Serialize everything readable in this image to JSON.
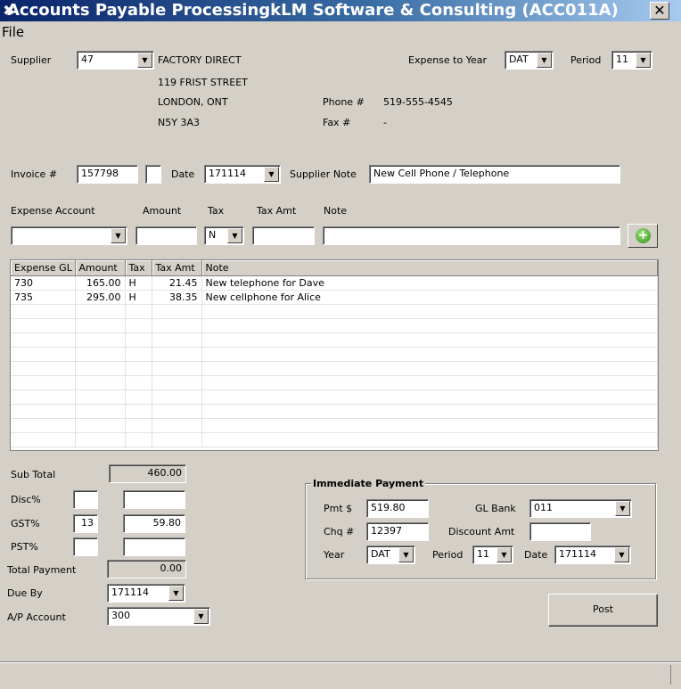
{
  "window": {
    "title": "Accounts Payable ProcessingkLM Software & Consulting (ACC011A)",
    "close_glyph": "✕"
  },
  "menu": {
    "file": "File"
  },
  "supplier": {
    "label": "Supplier",
    "code": "47",
    "name": "FACTORY DIRECT",
    "address1": "119 FRIST STREET",
    "address2": "LONDON, ONT",
    "postal": "N5Y 3A3",
    "phone_label": "Phone #",
    "phone": "519-555-4545",
    "fax_label": "Fax #",
    "fax": "-"
  },
  "expense_year": {
    "label": "Expense to Year",
    "value": "DAT"
  },
  "period": {
    "label": "Period",
    "value": "11"
  },
  "invoice": {
    "label": "Invoice #",
    "value": "157798",
    "date_label": "Date",
    "date": "171114",
    "note_label": "Supplier Note",
    "note": "New Cell Phone / Telephone"
  },
  "entry": {
    "expense_account_label": "Expense Account",
    "amount_label": "Amount",
    "tax_label": "Tax",
    "tax_value": "N",
    "tax_amt_label": "Tax Amt",
    "note_label": "Note",
    "add_icon": "plus-circle-icon"
  },
  "grid": {
    "columns": [
      "Expense GL",
      "Amount",
      "Tax",
      "Tax Amt",
      "Note"
    ],
    "rows": [
      [
        "730",
        "165.00",
        "H",
        "21.45",
        "New telephone for Dave"
      ],
      [
        "735",
        "295.00",
        "H",
        "38.35",
        "New cellphone for Alice"
      ]
    ],
    "empty_rows": 10
  },
  "totals": {
    "sub_total_label": "Sub Total",
    "sub_total": "460.00",
    "disc_label": "Disc%",
    "disc_pct": "",
    "disc_amt": "",
    "gst_label": "GST%",
    "gst_pct": "13",
    "gst_amt": "59.80",
    "pst_label": "PST%",
    "pst_pct": "",
    "pst_amt": "",
    "total_payment_label": "Total Payment",
    "total_payment": "0.00",
    "due_by_label": "Due By",
    "due_by": "171114",
    "ap_account_label": "A/P Account",
    "ap_account": "300"
  },
  "immediate_payment": {
    "title": "Immediate Payment",
    "pmt_label": "Pmt $",
    "pmt": "519.80",
    "gl_bank_label": "GL Bank",
    "gl_bank": "011",
    "chq_label": "Chq #",
    "chq": "12397",
    "discount_amt_label": "Discount Amt",
    "discount_amt": "",
    "year_label": "Year",
    "year": "DAT",
    "period_label": "Period",
    "period": "11",
    "date_label": "Date",
    "date": "171114"
  },
  "actions": {
    "post": "Post"
  },
  "colors": {
    "titlebar_start": "#0a246a",
    "titlebar_end": "#a6caf0",
    "face": "#d4d0c8"
  }
}
